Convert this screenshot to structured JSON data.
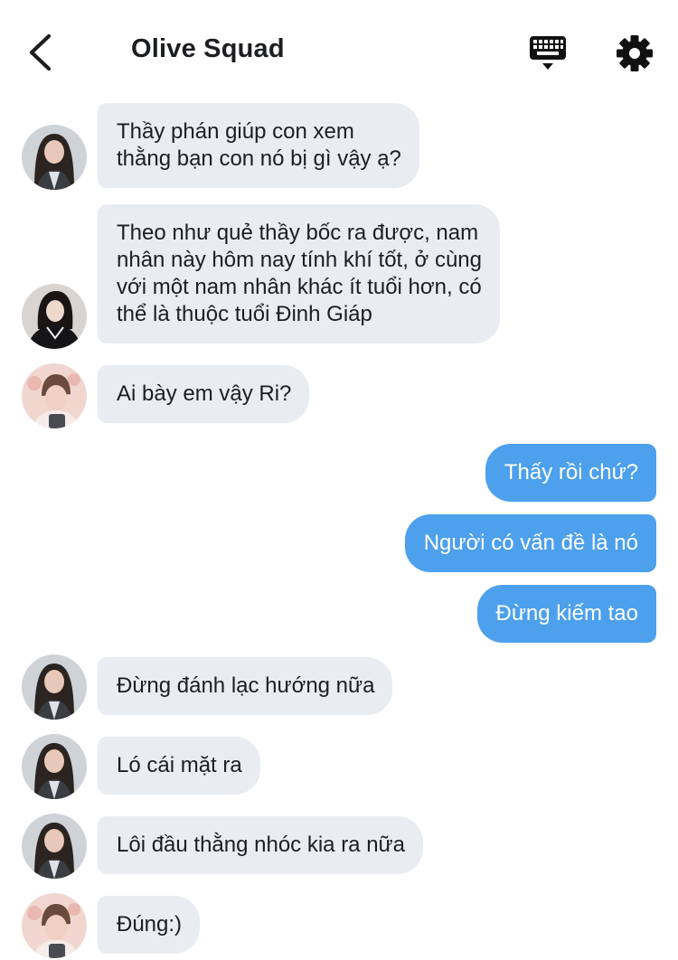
{
  "header": {
    "title": "Olive Squad",
    "back_icon": "chevron-left-icon",
    "keyboard_icon": "keyboard-icon",
    "settings_icon": "gear-icon"
  },
  "colors": {
    "incoming_bubble": "#e9ecf0",
    "outgoing_bubble": "#4ca0ec",
    "outgoing_text": "#ffffff",
    "text": "#1c1e21"
  },
  "messages": [
    {
      "side": "in",
      "avatar": "avatar-girl-long-hair",
      "lines": [
        "Thầy phán giúp con xem",
        "thằng bạn con nó bị gì vậy ạ?"
      ]
    },
    {
      "side": "in",
      "avatar": "avatar-girl-dark-outfit",
      "lines": [
        "Theo như quẻ thầy bốc ra được, nam",
        "nhân này hôm nay tính khí tốt, ở cùng",
        "với một nam nhân khác ít tuổi hơn, có",
        "thể là thuộc tuổi Đinh Giáp"
      ]
    },
    {
      "side": "in",
      "avatar": "avatar-boy-pink",
      "lines": [
        "Ai bày em vậy Ri?"
      ]
    },
    {
      "side": "out",
      "lines": [
        "Thấy rồi chứ?"
      ]
    },
    {
      "side": "out",
      "lines": [
        "Người có vấn đề là nó"
      ]
    },
    {
      "side": "out",
      "lines": [
        "Đừng kiếm tao"
      ]
    },
    {
      "side": "in",
      "avatar": "avatar-girl-long-hair",
      "lines": [
        "Đừng đánh lạc hướng nữa"
      ]
    },
    {
      "side": "in",
      "avatar": "avatar-girl-long-hair",
      "lines": [
        "Ló cái mặt ra"
      ]
    },
    {
      "side": "in",
      "avatar": "avatar-girl-long-hair",
      "lines": [
        "Lôi đầu thằng nhóc kia ra nữa"
      ]
    },
    {
      "side": "in",
      "avatar": "avatar-boy-pink",
      "lines": [
        "Đúng:)"
      ]
    }
  ]
}
